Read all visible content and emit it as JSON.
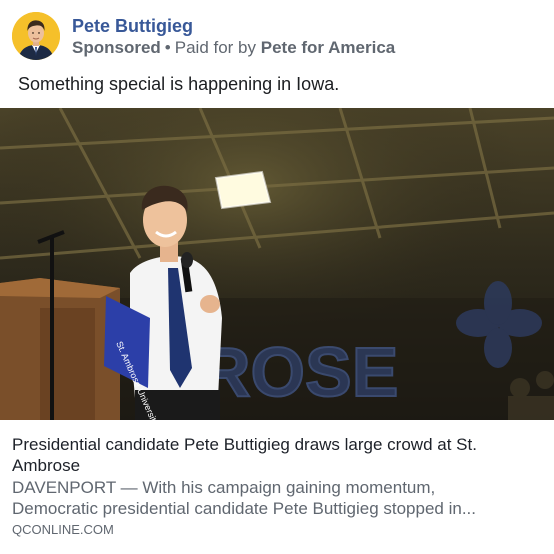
{
  "post": {
    "page_name": "Pete Buttigieg",
    "sponsored_label": "Sponsored",
    "separator": "•",
    "paid_for_prefix": "Paid for by",
    "paid_for_by": "Pete for America",
    "message": "Something special is happening in Iowa."
  },
  "media": {
    "icon": "photo",
    "podium_sign_text": "St. Ambrose University",
    "banner_text": "ROSE"
  },
  "link": {
    "title": "Presidential candidate Pete Buttigieg draws large crowd at St. Ambrose",
    "description_line1": "DAVENPORT — With his campaign gaining momentum,",
    "description_line2": "Democratic presidential candidate Pete Buttigieg stopped in...",
    "domain": "QCONLINE.COM"
  },
  "colors": {
    "page_name": "#385898",
    "meta": "#606770",
    "text": "#1c1e21",
    "avatar_bg": "#f5c02a"
  }
}
